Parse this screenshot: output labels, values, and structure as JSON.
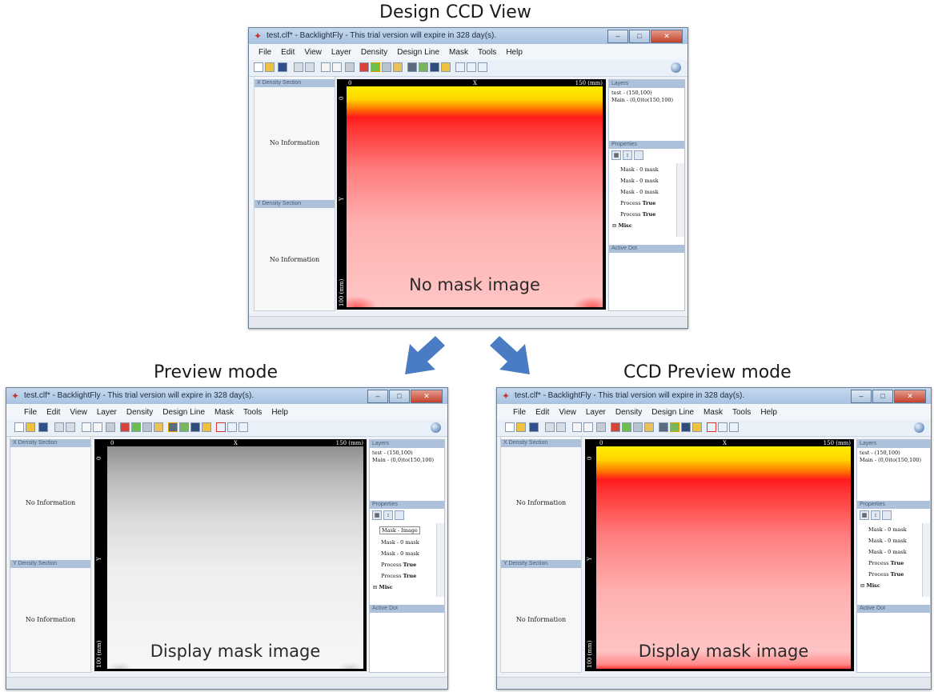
{
  "captions": {
    "top": "Design CCD View",
    "left": "Preview mode",
    "right": "CCD Preview mode"
  },
  "window": {
    "title": "test.clf* - BacklightFly - This trial version will expire in 328 day(s).",
    "title_right": "test.clf* - BacklightFly - This trial version will expire in 328 day(s).",
    "app_icon": "app-logo-icon",
    "menu": [
      "File",
      "Edit",
      "View",
      "Layer",
      "Density",
      "Design Line",
      "Mask",
      "Tools",
      "Help"
    ]
  },
  "left_panel": {
    "section_x": "X Density Section",
    "section_y": "Y Density Section",
    "no_info": "No Information"
  },
  "ruler": {
    "x_start": "0",
    "x_label": "X",
    "x_end": "150 (mm)",
    "y_start": "0",
    "y_label": "Y",
    "y_end": "100 (mm)"
  },
  "layers": {
    "header": "Layers",
    "items": [
      "test - (150,100)",
      "Main - (0,0)to(150,100)"
    ]
  },
  "properties": {
    "header": "Properties",
    "rows": [
      {
        "name": "Mask - ",
        "value": "0 mask"
      },
      {
        "name": "Mask - ",
        "value": "0 mask"
      },
      {
        "name": "Mask - ",
        "value": "0 mask"
      },
      {
        "name": "Process",
        "value": "True"
      },
      {
        "name": "Process",
        "value": "True"
      },
      {
        "name": "",
        "value": "Misc"
      }
    ],
    "preview_first_row": "Mask - Image"
  },
  "active_dot": {
    "header": "Active Dot"
  },
  "overlays": {
    "top": "No mask image",
    "left": "Display mask image",
    "right": "Display mask image"
  },
  "colors": {
    "arrow": "#4a7cc3",
    "heat_yellow": "#ffea00",
    "heat_red": "#ff1a1a"
  }
}
